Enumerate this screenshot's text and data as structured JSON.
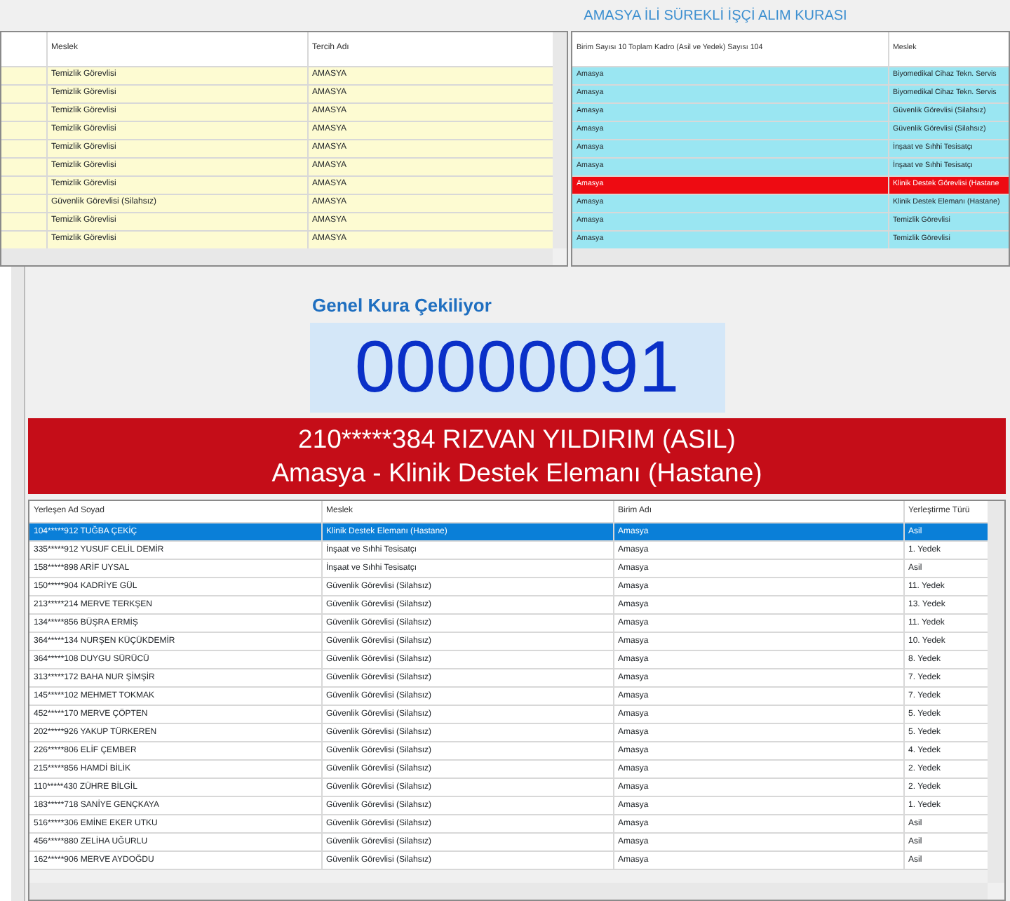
{
  "title": "AMASYA İLİ SÜREKLİ İŞÇİ ALIM KURASI",
  "left_table": {
    "columns": [
      "Meslek",
      "Tercih Adı"
    ],
    "rows": [
      {
        "cells": [
          "Temizlik Görevlisi",
          "AMASYA"
        ]
      },
      {
        "cells": [
          "Temizlik Görevlisi",
          "AMASYA"
        ]
      },
      {
        "cells": [
          "Temizlik Görevlisi",
          "AMASYA"
        ]
      },
      {
        "cells": [
          "Temizlik Görevlisi",
          "AMASYA"
        ]
      },
      {
        "cells": [
          "Temizlik Görevlisi",
          "AMASYA"
        ]
      },
      {
        "cells": [
          "Temizlik Görevlisi",
          "AMASYA"
        ]
      },
      {
        "cells": [
          "Temizlik Görevlisi",
          "AMASYA"
        ]
      },
      {
        "cells": [
          "Güvenlik Görevlisi (Silahsız)",
          "AMASYA"
        ]
      },
      {
        "cells": [
          "Temizlik Görevlisi",
          "AMASYA"
        ]
      },
      {
        "cells": [
          "Temizlik Görevlisi",
          "AMASYA"
        ]
      }
    ]
  },
  "right_table": {
    "columns": [
      "Birim Sayısı 10 Toplam Kadro (Asil ve Yedek) Sayısı 104",
      "Meslek"
    ],
    "rows": [
      {
        "cells": [
          "Amasya",
          "Biyomedikal Cihaz Tekn. Servis"
        ],
        "selected": false
      },
      {
        "cells": [
          "Amasya",
          "Biyomedikal Cihaz Tekn. Servis"
        ],
        "selected": false
      },
      {
        "cells": [
          "Amasya",
          "Güvenlik Görevlisi (Silahsız)"
        ],
        "selected": false
      },
      {
        "cells": [
          "Amasya",
          "Güvenlik Görevlisi (Silahsız)"
        ],
        "selected": false
      },
      {
        "cells": [
          "Amasya",
          "İnşaat ve Sıhhi Tesisatçı"
        ],
        "selected": false
      },
      {
        "cells": [
          "Amasya",
          "İnşaat ve Sıhhi Tesisatçı"
        ],
        "selected": false
      },
      {
        "cells": [
          "Amasya",
          "Klinik Destek Görevlisi (Hastane"
        ],
        "selected": true
      },
      {
        "cells": [
          "Amasya",
          "Klinik Destek Elemanı (Hastane)"
        ],
        "selected": false
      },
      {
        "cells": [
          "Amasya",
          "Temizlik Görevlisi"
        ],
        "selected": false
      },
      {
        "cells": [
          "Amasya",
          "Temizlik Görevlisi"
        ],
        "selected": false
      }
    ]
  },
  "draw_label": "Genel Kura Çekiliyor",
  "draw_number": "00000091",
  "winner": {
    "line_1": "210*****384 RIZVAN YILDIRIM (ASIL)",
    "line_2": "Amasya - Klinik Destek Elemanı (Hastane)"
  },
  "results": {
    "columns": [
      "Yerleşen Ad Soyad",
      "Meslek",
      "Birim Adı",
      "Yerleştirme Türü"
    ],
    "rows": [
      {
        "cells": [
          "104*****912 TUĞBA ÇEKİÇ",
          "Klinik Destek Elemanı (Hastane)",
          "Amasya",
          "Asil"
        ],
        "selected": true
      },
      {
        "cells": [
          "335*****912 YUSUF CELİL DEMİR",
          "İnşaat ve Sıhhi Tesisatçı",
          "Amasya",
          "1. Yedek"
        ],
        "selected": false
      },
      {
        "cells": [
          "158*****898 ARİF UYSAL",
          "İnşaat ve Sıhhi Tesisatçı",
          "Amasya",
          "Asil"
        ],
        "selected": false
      },
      {
        "cells": [
          "150*****904 KADRİYE GÜL",
          "Güvenlik Görevlisi (Silahsız)",
          "Amasya",
          "11. Yedek"
        ],
        "selected": false
      },
      {
        "cells": [
          "213*****214 MERVE TERKŞEN",
          "Güvenlik Görevlisi (Silahsız)",
          "Amasya",
          "13. Yedek"
        ],
        "selected": false
      },
      {
        "cells": [
          "134*****856 BÜŞRA ERMİŞ",
          "Güvenlik Görevlisi (Silahsız)",
          "Amasya",
          "11. Yedek"
        ],
        "selected": false
      },
      {
        "cells": [
          "364*****134 NURŞEN KÜÇÜKDEMİR",
          "Güvenlik Görevlisi (Silahsız)",
          "Amasya",
          "10. Yedek"
        ],
        "selected": false
      },
      {
        "cells": [
          "364*****108 DUYGU SÜRÜCÜ",
          "Güvenlik Görevlisi (Silahsız)",
          "Amasya",
          "8. Yedek"
        ],
        "selected": false
      },
      {
        "cells": [
          "313*****172 BAHA NUR ŞİMŞİR",
          "Güvenlik Görevlisi (Silahsız)",
          "Amasya",
          "7. Yedek"
        ],
        "selected": false
      },
      {
        "cells": [
          "145*****102 MEHMET TOKMAK",
          "Güvenlik Görevlisi (Silahsız)",
          "Amasya",
          "7. Yedek"
        ],
        "selected": false
      },
      {
        "cells": [
          "452*****170 MERVE ÇÖPTEN",
          "Güvenlik Görevlisi (Silahsız)",
          "Amasya",
          "5. Yedek"
        ],
        "selected": false
      },
      {
        "cells": [
          "202*****926 YAKUP TÜRKEREN",
          "Güvenlik Görevlisi (Silahsız)",
          "Amasya",
          "5. Yedek"
        ],
        "selected": false
      },
      {
        "cells": [
          "226*****806 ELİF ÇEMBER",
          "Güvenlik Görevlisi (Silahsız)",
          "Amasya",
          "4. Yedek"
        ],
        "selected": false
      },
      {
        "cells": [
          "215*****856 HAMDİ BİLİK",
          "Güvenlik Görevlisi (Silahsız)",
          "Amasya",
          "2. Yedek"
        ],
        "selected": false
      },
      {
        "cells": [
          "110*****430 ZÜHRE BİLGİL",
          "Güvenlik Görevlisi (Silahsız)",
          "Amasya",
          "2. Yedek"
        ],
        "selected": false
      },
      {
        "cells": [
          "183*****718 SANİYE GENÇKAYA",
          "Güvenlik Görevlisi (Silahsız)",
          "Amasya",
          "1. Yedek"
        ],
        "selected": false
      },
      {
        "cells": [
          "516*****306 EMİNE EKER UTKU",
          "Güvenlik Görevlisi (Silahsız)",
          "Amasya",
          "Asil"
        ],
        "selected": false
      },
      {
        "cells": [
          "456*****880 ZELİHA UĞURLU",
          "Güvenlik Görevlisi (Silahsız)",
          "Amasya",
          "Asil"
        ],
        "selected": false
      },
      {
        "cells": [
          "162*****906 MERVE AYDOĞDU",
          "Güvenlik Görevlisi (Silahsız)",
          "Amasya",
          "Asil"
        ],
        "selected": false
      }
    ]
  }
}
